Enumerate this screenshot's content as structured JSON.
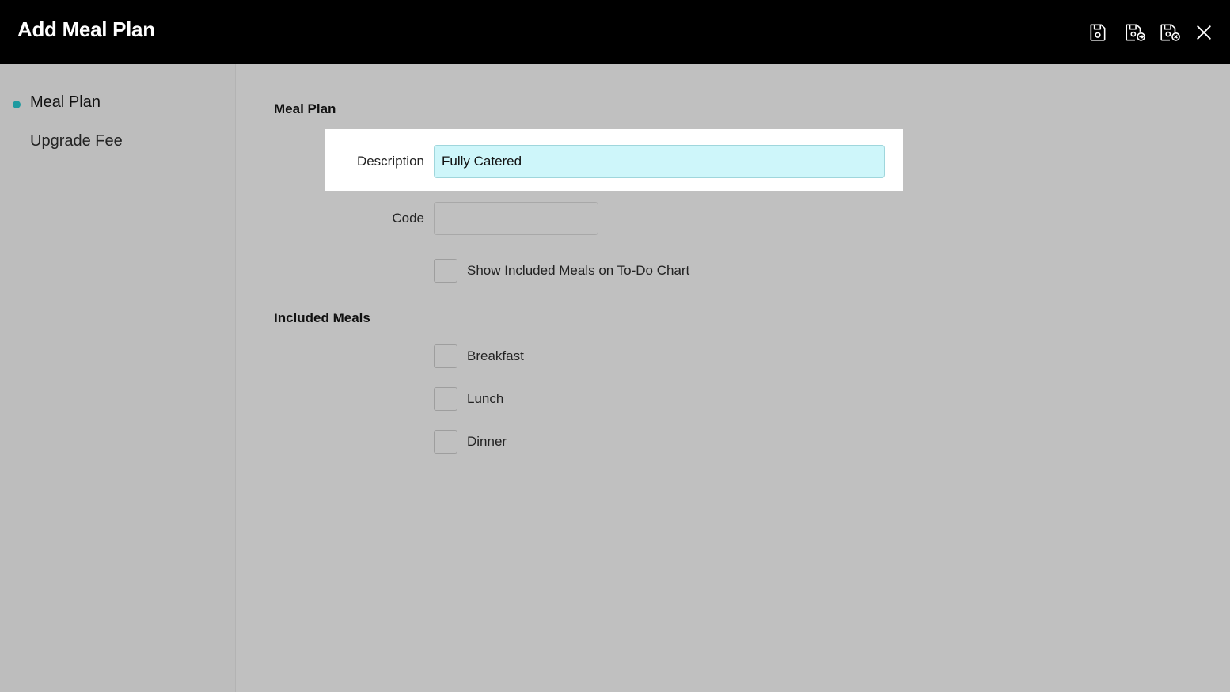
{
  "header": {
    "title": "Add Meal Plan",
    "actions": [
      {
        "name": "save-icon",
        "label": "Save"
      },
      {
        "name": "save-and-new-icon",
        "label": "Save and New"
      },
      {
        "name": "save-and-close-icon",
        "label": "Save and Close"
      },
      {
        "name": "close-icon",
        "label": "Close"
      }
    ]
  },
  "sidebar": {
    "items": [
      {
        "label": "Meal Plan",
        "active": true
      },
      {
        "label": "Upgrade Fee",
        "active": false
      }
    ]
  },
  "form": {
    "meal_plan_section": "Meal Plan",
    "description": {
      "label": "Description",
      "value": "Fully Catered"
    },
    "code": {
      "label": "Code",
      "value": ""
    },
    "show_on_todo": {
      "label": "Show Included Meals on To-Do Chart",
      "checked": false
    },
    "included_meals_section": "Included Meals",
    "meals": [
      {
        "label": "Breakfast",
        "checked": false
      },
      {
        "label": "Lunch",
        "checked": false
      },
      {
        "label": "Dinner",
        "checked": false
      }
    ]
  },
  "colors": {
    "accent": "#1e9aa0",
    "focused_input": "#cef6fa",
    "header_bg": "#000000",
    "page_bg": "#c0c0c0"
  }
}
